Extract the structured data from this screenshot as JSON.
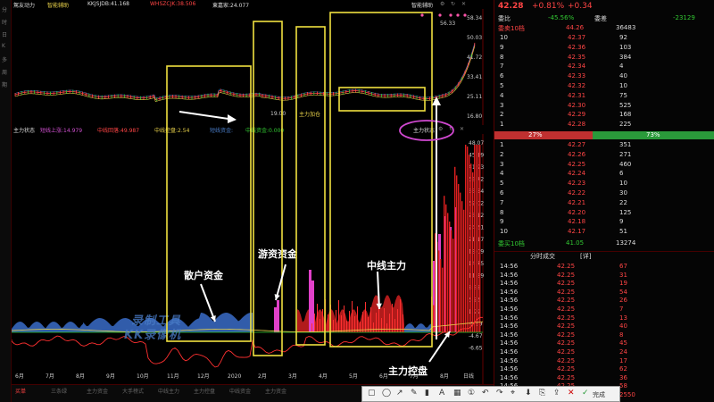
{
  "window": {
    "title": "智能辅助"
  },
  "left_toolbar": {
    "glyphs": [
      "分",
      "时",
      "日",
      "K",
      "多",
      "周",
      "期"
    ]
  },
  "header": {
    "name": "駕友动力",
    "indicator": "智能辅助",
    "items": [
      {
        "label": "KKJSJDB:41.168",
        "color": "#dddddd"
      },
      {
        "label": "WHSZCJK:38.506",
        "color": "#ff4545"
      },
      {
        "label": "東嘉家:24.077",
        "color": "#dddddd"
      }
    ],
    "right_label": "智能辅助"
  },
  "sub_header": {
    "name": "主力状态",
    "items": [
      {
        "label": "短线上涨:14.979",
        "color": "#d050d0"
      },
      {
        "label": "中线回落:49.987",
        "color": "#ff4545"
      },
      {
        "label": "中线控盘:2.54",
        "color": "#e8d14a"
      },
      {
        "label": "短线资金:",
        "color": "#4a7dc8"
      },
      {
        "label": "中线资金:0.000",
        "color": "#32c832"
      }
    ],
    "right_label": "主力状态"
  },
  "price_axis": [
    "58.34",
    "50.03",
    "41.72",
    "33.41",
    "25.11",
    "16.80"
  ],
  "indicator_axis": [
    "48.07",
    "45.19",
    "41.93",
    "38.72",
    "35.54",
    "32.02",
    "28.12",
    "24.31",
    "21.17",
    "18.09",
    "14.75",
    "11.89",
    "8.38",
    "5.23",
    "1.99",
    "-1.99",
    "-4.67",
    "-6.65"
  ],
  "x_axis": [
    "6月",
    "7月",
    "8月",
    "9月",
    "10月",
    "11月",
    "12月",
    "2020",
    "2月",
    "3月",
    "4月",
    "5月",
    "6月",
    "7月",
    "8月"
  ],
  "chart_labels": {
    "peak": "56.33",
    "low": "19.00",
    "main_add": "主力加仓"
  },
  "annotations": {
    "retail": "散户资金",
    "hot_money": "游资资金",
    "mid_line": "中线主力",
    "control": "主力控盘"
  },
  "watermark": {
    "line1": "录制工具",
    "line2": "KK录像机"
  },
  "bottom_tabs": [
    "买单",
    "三条绿",
    "主力资金",
    "大手榜式",
    "中线主力",
    "主力控盘",
    "中线资金",
    "主力资金"
  ],
  "bottom_right": "日线",
  "order_book": {
    "price": "42.28",
    "change_pct": "+0.81%",
    "change": "+0.34",
    "ratio_label": "委比",
    "ratio_value": "-45.56%",
    "diff_label": "委差",
    "diff_value": "-23129",
    "sell_header": {
      "label": "委卖10档",
      "price": "44.26",
      "volume": "36483"
    },
    "sells": [
      {
        "level": "10",
        "price": "42.37",
        "volume": "92"
      },
      {
        "level": "9",
        "price": "42.36",
        "volume": "103"
      },
      {
        "level": "8",
        "price": "42.35",
        "volume": "384"
      },
      {
        "level": "7",
        "price": "42.34",
        "volume": "4"
      },
      {
        "level": "6",
        "price": "42.33",
        "volume": "40"
      },
      {
        "level": "5",
        "price": "42.32",
        "volume": "10"
      },
      {
        "level": "4",
        "price": "42.31",
        "volume": "75"
      },
      {
        "level": "3",
        "price": "42.30",
        "volume": "525"
      },
      {
        "level": "2",
        "price": "42.29",
        "volume": "168"
      },
      {
        "level": "1",
        "price": "42.28",
        "volume": "225"
      }
    ],
    "split_left": "27%",
    "split_right": "73%",
    "buys": [
      {
        "level": "1",
        "price": "42.27",
        "volume": "351"
      },
      {
        "level": "2",
        "price": "42.26",
        "volume": "271"
      },
      {
        "level": "3",
        "price": "42.25",
        "volume": "460"
      },
      {
        "level": "4",
        "price": "42.24",
        "volume": "6"
      },
      {
        "level": "5",
        "price": "42.23",
        "volume": "10"
      },
      {
        "level": "6",
        "price": "42.22",
        "volume": "30"
      },
      {
        "level": "7",
        "price": "42.21",
        "volume": "22"
      },
      {
        "level": "8",
        "price": "42.20",
        "volume": "125"
      },
      {
        "level": "9",
        "price": "42.18",
        "volume": "9"
      },
      {
        "level": "10",
        "price": "42.17",
        "volume": "51"
      }
    ],
    "buy_footer": {
      "label": "委买10档",
      "price": "41.05",
      "volume": "13274"
    }
  },
  "trades": {
    "title": "分时成交",
    "detail": "[详]",
    "rows": [
      {
        "time": "14:56",
        "price": "42.25",
        "volume": "67"
      },
      {
        "time": "14:56",
        "price": "42.25",
        "volume": "31"
      },
      {
        "time": "14:56",
        "price": "42.25",
        "volume": "19"
      },
      {
        "time": "14:56",
        "price": "42.25",
        "volume": "54"
      },
      {
        "time": "14:56",
        "price": "42.25",
        "volume": "26"
      },
      {
        "time": "14:56",
        "price": "42.25",
        "volume": "7"
      },
      {
        "time": "14:56",
        "price": "42.25",
        "volume": "13"
      },
      {
        "time": "14:56",
        "price": "42.25",
        "volume": "40"
      },
      {
        "time": "14:56",
        "price": "42.25",
        "volume": "8"
      },
      {
        "time": "14:56",
        "price": "42.25",
        "volume": "45"
      },
      {
        "time": "14:56",
        "price": "42.25",
        "volume": "24"
      },
      {
        "time": "14:56",
        "price": "42.25",
        "volume": "17"
      },
      {
        "time": "14:56",
        "price": "42.25",
        "volume": "62"
      },
      {
        "time": "14:56",
        "price": "42.25",
        "volume": "36"
      },
      {
        "time": "14:56",
        "price": "42.25",
        "volume": "58"
      },
      {
        "time": "15:00",
        "price": "42.28",
        "volume": "2550"
      }
    ]
  },
  "trade_toolbar": {
    "done": "完成"
  },
  "colors": {
    "up": "#ff4545",
    "down": "#32c832",
    "box": "#f0e040",
    "circle": "#d048d0"
  }
}
